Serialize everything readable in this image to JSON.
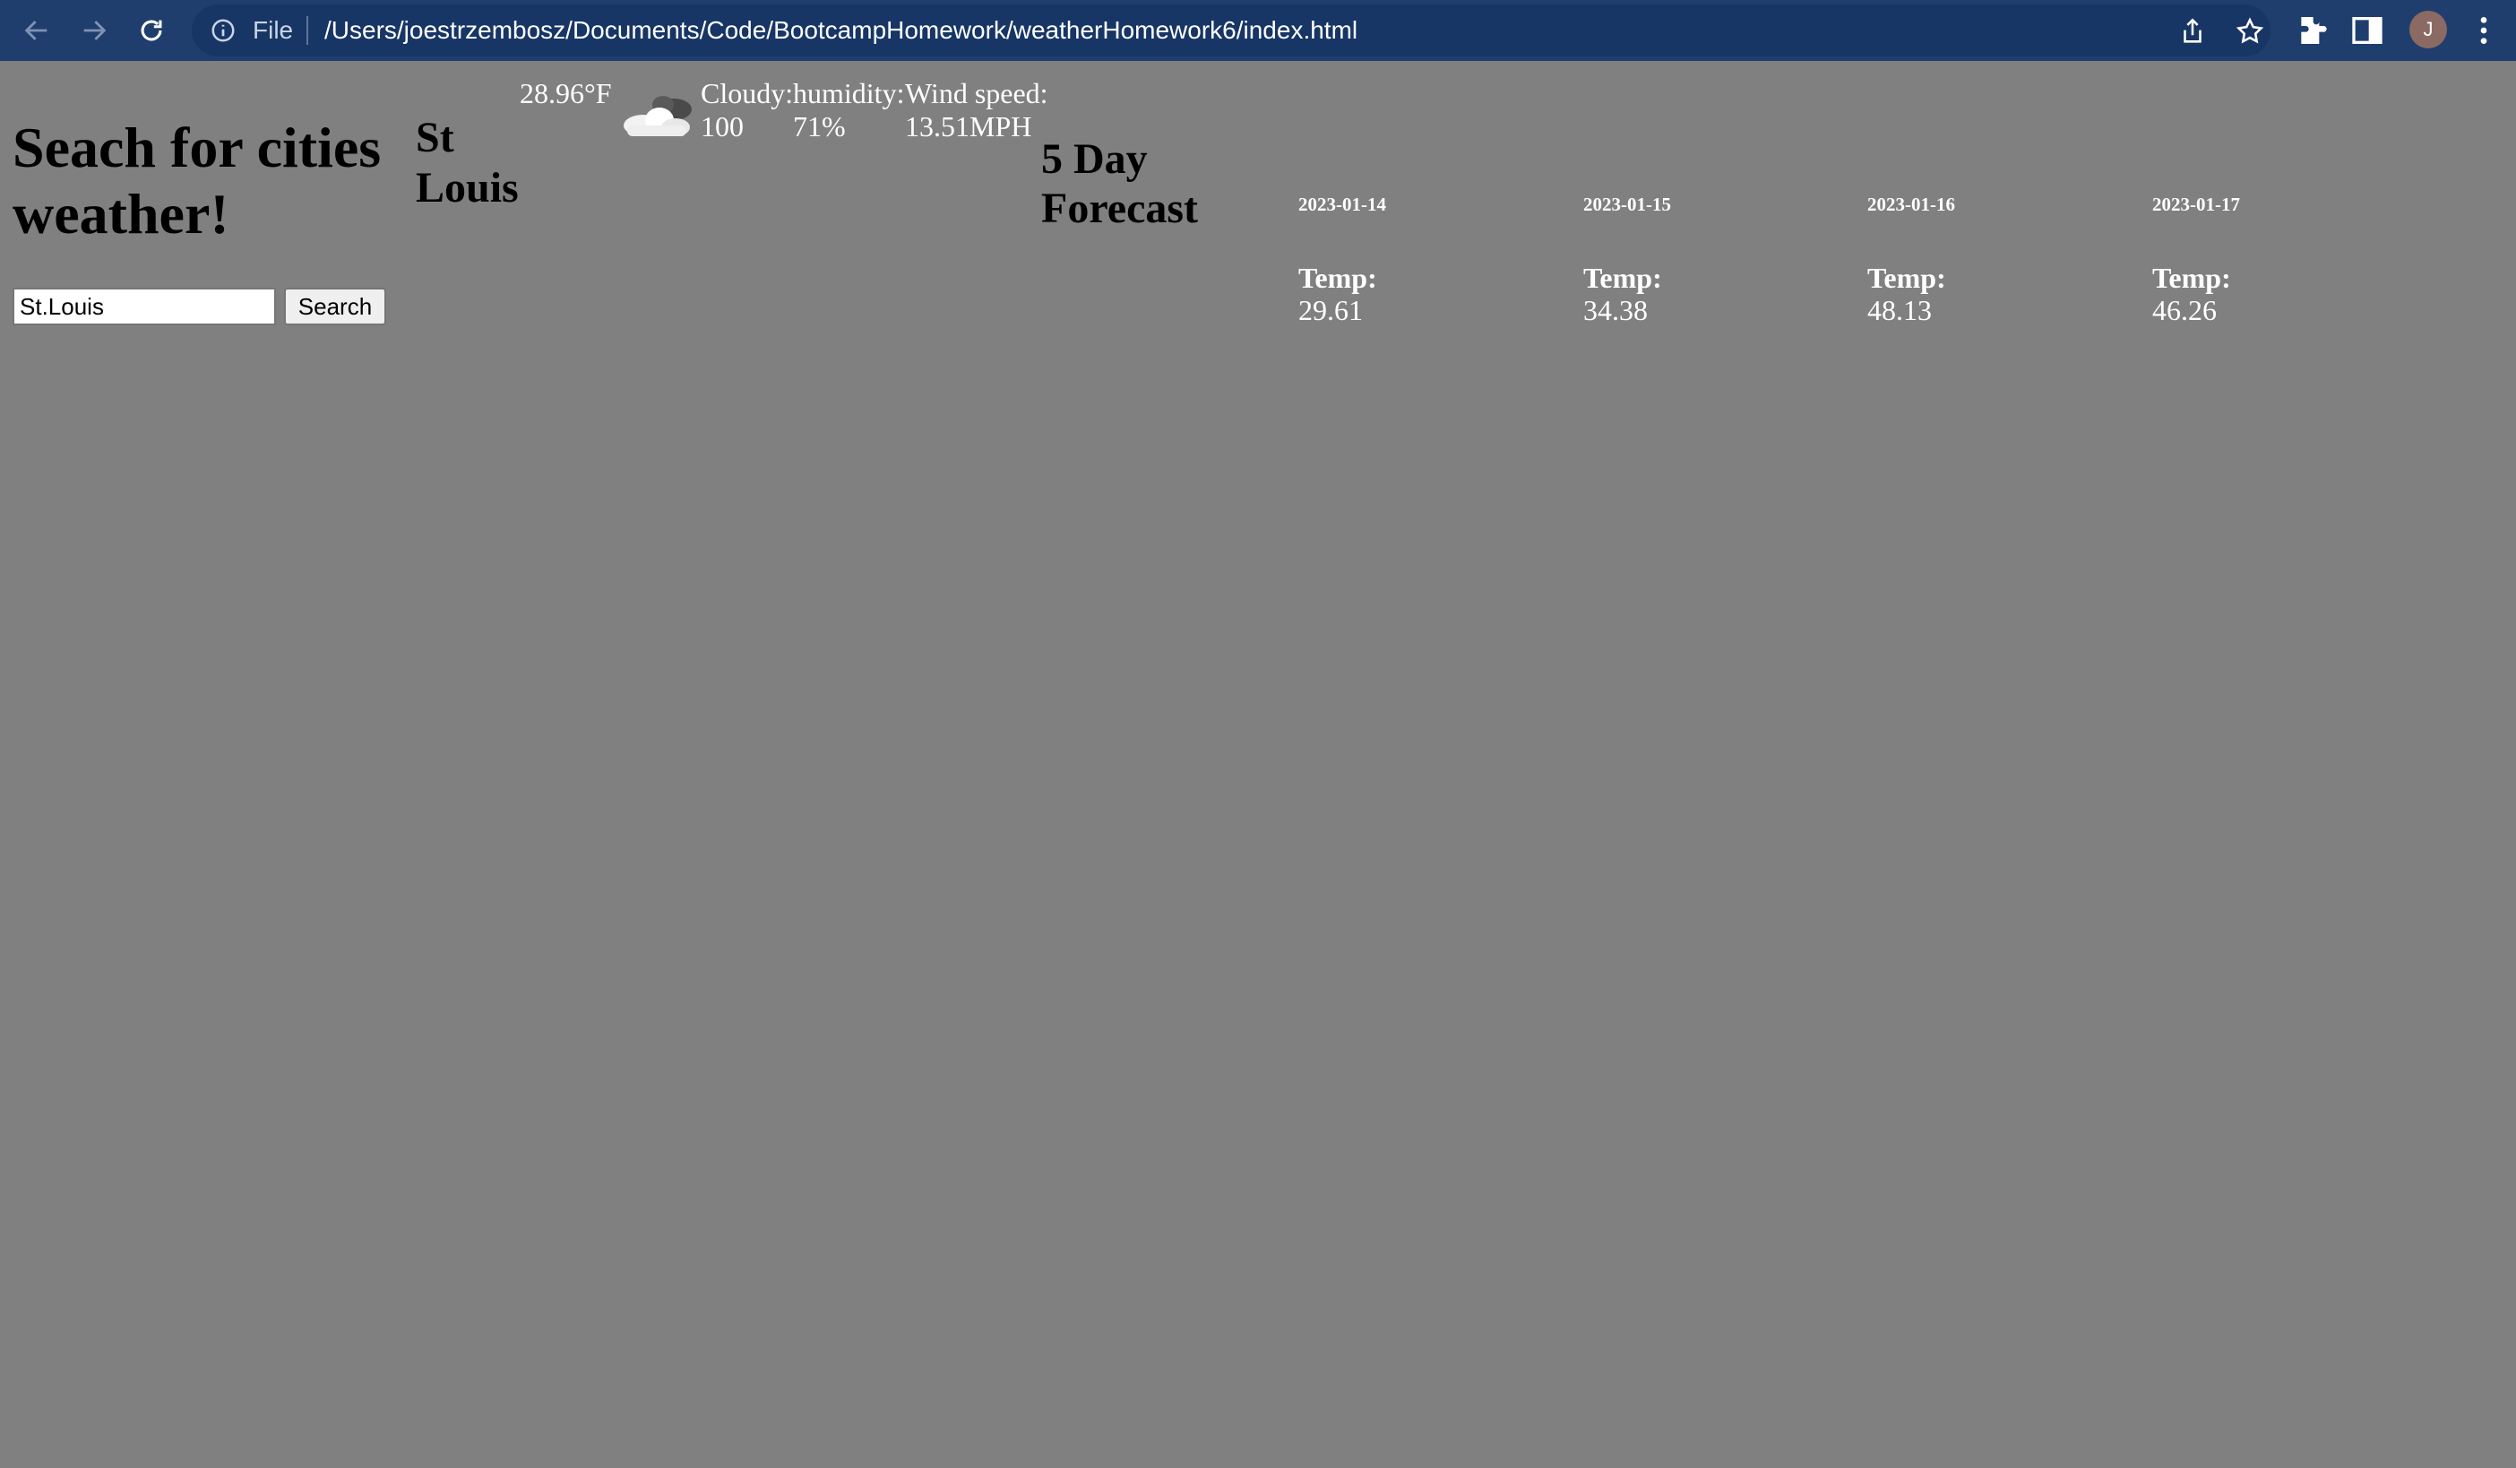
{
  "browser": {
    "file_label": "File",
    "url": "/Users/joestrzembosz/Documents/Code/BootcampHomework/weatherHomework6/index.html",
    "profile_initial": "J",
    "icons": [
      "back-arrow-icon",
      "forward-arrow-icon",
      "reload-icon",
      "info-icon",
      "share-icon",
      "star-icon",
      "extensions-icon",
      "side-panel-icon",
      "kebab-menu-icon"
    ]
  },
  "page": {
    "heading": "Seach for cities weather!",
    "search": {
      "value": "St.Louis",
      "button_label": "Search"
    }
  },
  "current": {
    "city": "St Louis",
    "temp": "28.96°F",
    "icon": "cloud-icon",
    "cloudiness": "Cloudy: 100",
    "humidity": "humidity: 71%",
    "wind": "Wind speed: 13.51MPH"
  },
  "forecast": {
    "heading": "5 Day Forecast",
    "temp_label": "Temp:",
    "days": [
      {
        "date": "2023-01-14",
        "temp": "29.61"
      },
      {
        "date": "2023-01-15",
        "temp": "34.38"
      },
      {
        "date": "2023-01-16",
        "temp": "48.13"
      },
      {
        "date": "2023-01-17",
        "temp": "46.26"
      }
    ]
  },
  "colors": {
    "page_background": "#808080",
    "browser_bar": "#1f3e6e",
    "omnibox": "#173565"
  }
}
